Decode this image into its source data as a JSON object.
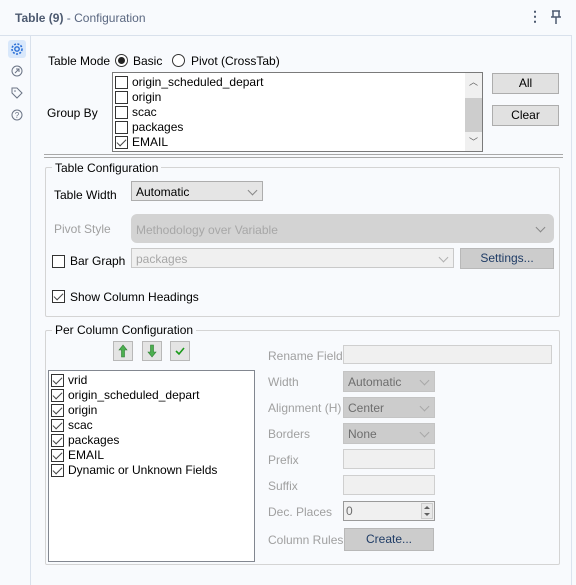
{
  "header": {
    "title_bold": "Table (9)",
    "title_rest": " - Configuration",
    "menu_icon": "kebab-menu-icon",
    "pin_icon": "pin-icon"
  },
  "sidebar": {
    "items": [
      {
        "icon": "gear-icon",
        "active": true
      },
      {
        "icon": "arrow-circle-icon",
        "active": false
      },
      {
        "icon": "tag-icon",
        "active": false
      },
      {
        "icon": "help-icon",
        "active": false
      }
    ]
  },
  "table_mode": {
    "label": "Table Mode",
    "options": [
      {
        "label": "Basic",
        "selected": true
      },
      {
        "label": "Pivot (CrossTab)",
        "selected": false
      }
    ]
  },
  "group_by": {
    "label": "Group By",
    "items": [
      {
        "label": "origin_scheduled_depart",
        "checked": false
      },
      {
        "label": "origin",
        "checked": false
      },
      {
        "label": "scac",
        "checked": false
      },
      {
        "label": "packages",
        "checked": false
      },
      {
        "label": "EMAIL",
        "checked": true
      }
    ],
    "all_label": "All",
    "clear_label": "Clear"
  },
  "table_configuration": {
    "title": "Table Configuration",
    "table_width_label": "Table Width",
    "table_width_value": "Automatic",
    "pivot_style_label": "Pivot Style",
    "pivot_style_value": "Methodology over Variable",
    "bar_graph_label": "Bar Graph",
    "bar_graph_checked": false,
    "bar_graph_field": "packages",
    "settings_label": "Settings...",
    "show_headings_label": "Show Column Headings",
    "show_headings_checked": true
  },
  "per_column": {
    "title": "Per Column Configuration",
    "move_up_icon": "arrow-up-icon",
    "move_down_icon": "arrow-down-icon",
    "check_all_icon": "checkmark-icon",
    "fields": [
      {
        "label": "vrid",
        "checked": true
      },
      {
        "label": "origin_scheduled_depart",
        "checked": true
      },
      {
        "label": "origin",
        "checked": true
      },
      {
        "label": "scac",
        "checked": true
      },
      {
        "label": "packages",
        "checked": true
      },
      {
        "label": "EMAIL",
        "checked": true
      },
      {
        "label": "Dynamic or Unknown Fields",
        "checked": true
      }
    ],
    "rename_label": "Rename Field",
    "rename_value": "",
    "width_label": "Width",
    "width_value": "Automatic",
    "alignment_label": "Alignment (H)",
    "alignment_value": "Center",
    "borders_label": "Borders",
    "borders_value": "None",
    "prefix_label": "Prefix",
    "prefix_value": "",
    "suffix_label": "Suffix",
    "suffix_value": "",
    "dec_places_label": "Dec. Places",
    "dec_places_value": "0",
    "column_rules_label": "Column Rules",
    "create_label": "Create..."
  }
}
